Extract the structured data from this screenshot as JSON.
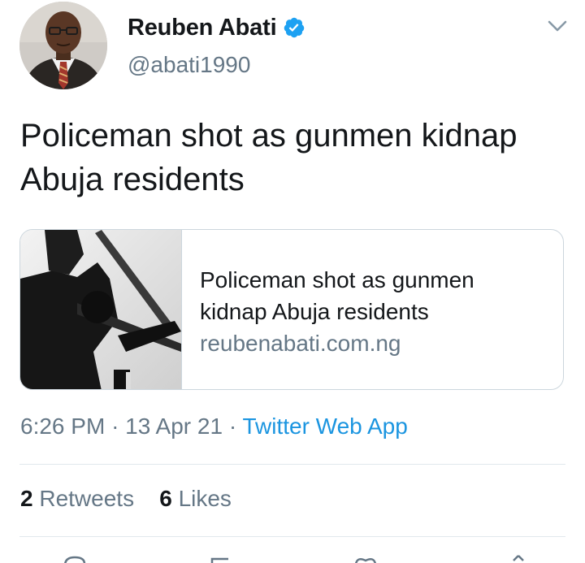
{
  "author": {
    "display_name": "Reuben Abati",
    "handle": "@abati1990",
    "verified": true
  },
  "tweet": {
    "text": "Policeman shot as gunmen kidnap Abuja residents"
  },
  "card": {
    "title": "Policeman shot as gunmen kidnap Abuja residents",
    "domain": "reubenabati.com.ng"
  },
  "meta": {
    "time": "6:26 PM",
    "separator": "·",
    "date": "13 Apr 21",
    "source": "Twitter Web App"
  },
  "stats": {
    "retweets_count": "2",
    "retweets_label": "Retweets",
    "likes_count": "6",
    "likes_label": "Likes"
  },
  "colors": {
    "accent": "#1b95e0",
    "secondary_text": "#657786",
    "primary_text": "#14171a",
    "border": "#ccd6dd"
  },
  "icons": {
    "verified": "verified-badge-icon",
    "menu": "chevron-down-icon",
    "reply": "reply-icon",
    "retweet": "retweet-icon",
    "like": "heart-icon",
    "share": "share-icon"
  }
}
